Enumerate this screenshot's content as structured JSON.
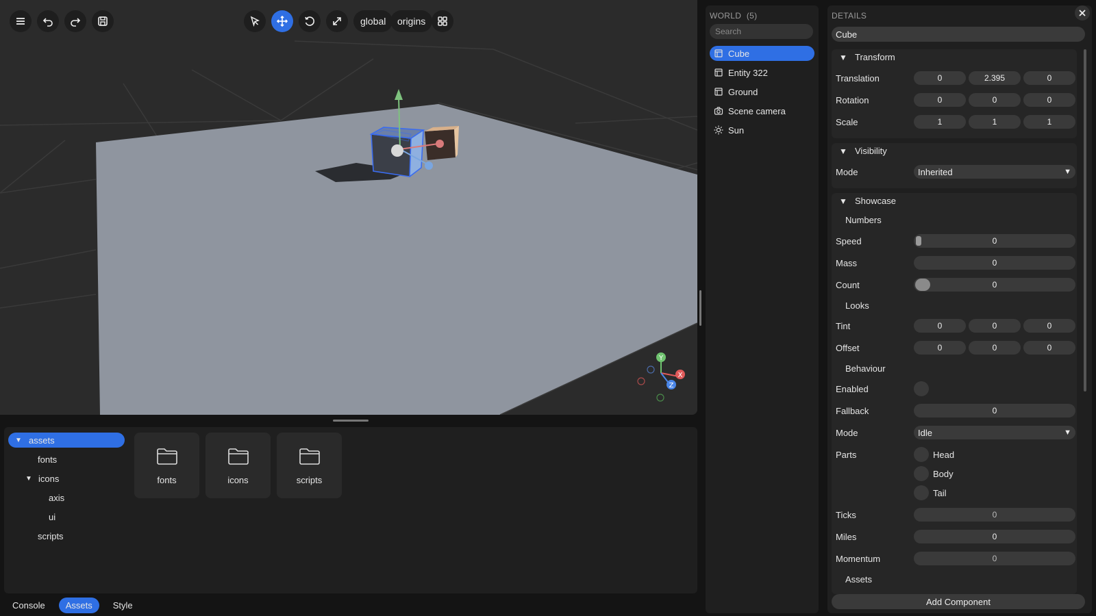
{
  "toolbar": {
    "menu_icon": "hamburger-icon",
    "undo_icon": "undo-icon",
    "redo_icon": "redo-icon",
    "save_icon": "save-icon",
    "select_icon": "cursor-icon",
    "move_icon": "move-icon",
    "rotate_icon": "rotate-icon",
    "scale_icon": "scale-icon",
    "space_label": "global",
    "pivot_label": "origins",
    "grid_icon": "grid-icon"
  },
  "gizmo": {
    "y": "Y",
    "x": "X",
    "z": "Z"
  },
  "assets": {
    "tree": [
      {
        "label": "assets",
        "expanded": true,
        "selected": true
      },
      {
        "label": "fonts"
      },
      {
        "label": "icons",
        "expanded": true
      },
      {
        "label": "axis"
      },
      {
        "label": "ui"
      },
      {
        "label": "scripts"
      }
    ],
    "folders": [
      "fonts",
      "icons",
      "scripts"
    ]
  },
  "bottom_tabs": [
    {
      "label": "Console",
      "active": false
    },
    {
      "label": "Assets",
      "active": true
    },
    {
      "label": "Style",
      "active": false
    }
  ],
  "world": {
    "title": "WORLD",
    "count": "(5)",
    "search_placeholder": "Search",
    "entities": [
      {
        "label": "Cube",
        "icon": "mesh-icon",
        "selected": true
      },
      {
        "label": "Entity 322",
        "icon": "mesh-icon"
      },
      {
        "label": "Ground",
        "icon": "mesh-icon"
      },
      {
        "label": "Scene camera",
        "icon": "camera-icon"
      },
      {
        "label": "Sun",
        "icon": "sun-icon"
      }
    ]
  },
  "details": {
    "title": "DETAILS",
    "name": "Cube",
    "transform": {
      "title": "Transform",
      "translation_label": "Translation",
      "translation": [
        "0",
        "2.395",
        "0"
      ],
      "rotation_label": "Rotation",
      "rotation": [
        "0",
        "0",
        "0"
      ],
      "scale_label": "Scale",
      "scale": [
        "1",
        "1",
        "1"
      ]
    },
    "visibility": {
      "title": "Visibility",
      "mode_label": "Mode",
      "mode": "Inherited"
    },
    "showcase": {
      "title": "Showcase",
      "numbers_title": "Numbers",
      "speed_label": "Speed",
      "speed": "0",
      "mass_label": "Mass",
      "mass": "0",
      "count_label": "Count",
      "count": "0",
      "looks_title": "Looks",
      "tint_label": "Tint",
      "tint": [
        "0",
        "0",
        "0"
      ],
      "offset_label": "Offset",
      "offset": [
        "0",
        "0",
        "0"
      ],
      "behaviour_title": "Behaviour",
      "enabled_label": "Enabled",
      "fallback_label": "Fallback",
      "fallback": "0",
      "mode_label": "Mode",
      "mode": "Idle",
      "parts_label": "Parts",
      "parts": [
        "Head",
        "Body",
        "Tail"
      ],
      "ticks_label": "Ticks",
      "ticks": "0",
      "miles_label": "Miles",
      "miles": "0",
      "momentum_label": "Momentum",
      "momentum": "0",
      "assets_title": "Assets"
    },
    "add_component": "Add Component"
  },
  "colors": {
    "accent": "#2f6fe4",
    "panel": "#1f1f1f",
    "field": "#3a3a3a"
  }
}
